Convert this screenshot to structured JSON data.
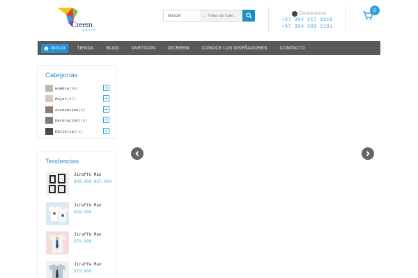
{
  "header": {
    "logo": {
      "text": "Creem",
      "tagline": "diseño & estilo"
    },
    "search": {
      "placeholder": "Buscar",
      "category_selected": "Todas las Cate...",
      "button_icon": "search-icon"
    },
    "contact": {
      "title": "Contactanos",
      "icon": "whatsapp-icon",
      "phones": [
        "+57 304 217 1616",
        "+57 304 389 6181"
      ]
    },
    "cart": {
      "icon": "cart-icon",
      "count": "0"
    }
  },
  "nav": {
    "items": [
      {
        "label": "INICIO",
        "icon": "home-icon",
        "active": true
      },
      {
        "label": "TIENDA"
      },
      {
        "label": "BLOG"
      },
      {
        "label": "PARTICIPA"
      },
      {
        "label": "DICREEM"
      },
      {
        "label": "CONOCE LOS DISEÑADORES"
      },
      {
        "label": "CONTACTO"
      }
    ]
  },
  "sidebar": {
    "categories": {
      "title": "Categorías",
      "items": [
        {
          "label": "Hombre",
          "count": "(86)"
        },
        {
          "label": "Mujer",
          "count": "(97)"
        },
        {
          "label": "Accesorios",
          "count": "(8)"
        },
        {
          "label": "Decoración",
          "count": "(18)"
        },
        {
          "label": "Editorial",
          "count": "(1)"
        }
      ]
    },
    "trends": {
      "title": "Tendencias",
      "items": [
        {
          "name": "Jiraffe Man",
          "price": "$48.000-$97.000"
        },
        {
          "name": "Jiraffe Man",
          "price": "$29.000"
        },
        {
          "name": "Jiraffe Man",
          "price": "$70.000"
        },
        {
          "name": "Jiraffe Man",
          "price": "$70.000"
        }
      ]
    }
  },
  "slider": {
    "prev_icon": "chevron-left-icon",
    "next_icon": "chevron-right-icon"
  },
  "colors": {
    "accent": "#2591d1",
    "nav_bg": "#595959",
    "price": "#4eb0e0"
  }
}
